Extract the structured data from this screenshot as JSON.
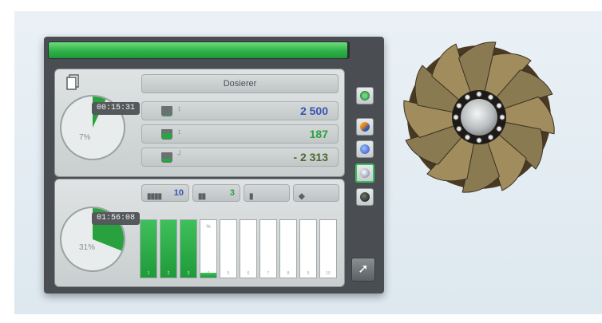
{
  "colors": {
    "accent_green": "#2fb248",
    "value_blue": "#3a52b0",
    "value_green": "#2aa13f",
    "value_dark_green": "#4a6a2a",
    "panel_dark": "#4a4e52"
  },
  "header": {
    "progress_fraction": 0.99
  },
  "dosing": {
    "title": "Dosierer",
    "timer": "00:15:31",
    "percent": "7%",
    "gauge_fraction": 0.07,
    "rows": [
      {
        "value": "2 500",
        "marker": "↕",
        "fill_fraction": 0.05,
        "color_key": "value_blue"
      },
      {
        "value": "187",
        "marker": "↕",
        "fill_fraction": 0.6,
        "color_key": "value_green"
      },
      {
        "value": "- 2 313",
        "marker": "┘",
        "fill_fraction": 0.4,
        "color_key": "value_dark_green"
      }
    ]
  },
  "batch": {
    "timer": "01:56:08",
    "percent": "31%",
    "gauge_fraction": 0.31,
    "chips": [
      {
        "icon": "rack-icon",
        "count": "10"
      },
      {
        "icon": "containers-icon",
        "count": "3"
      },
      {
        "icon": "cup-icon",
        "count": ""
      },
      {
        "icon": "pour-icon",
        "count": ""
      }
    ],
    "bars": [
      {
        "num": "1",
        "fill": 1.0,
        "mark": ""
      },
      {
        "num": "2",
        "fill": 1.0,
        "mark": ""
      },
      {
        "num": "3",
        "fill": 1.0,
        "mark": ""
      },
      {
        "num": "4",
        "fill": 0.08,
        "mark": "%"
      },
      {
        "num": "5",
        "fill": 0,
        "mark": ""
      },
      {
        "num": "6",
        "fill": 0,
        "mark": ""
      },
      {
        "num": "7",
        "fill": 0,
        "mark": ""
      },
      {
        "num": "8",
        "fill": 0,
        "mark": ""
      },
      {
        "num": "9",
        "fill": 0,
        "mark": ""
      },
      {
        "num": "10",
        "fill": 0,
        "mark": ""
      }
    ]
  },
  "side_buttons": [
    {
      "icon": "target-icon",
      "active": false
    },
    {
      "icon": "color-mix-icon",
      "active": false
    },
    {
      "icon": "blue-drop-icon",
      "active": false
    },
    {
      "icon": "gray-drop-icon",
      "active": true
    },
    {
      "icon": "black-drop-icon",
      "active": false
    }
  ],
  "exit_icon": "exit-icon"
}
